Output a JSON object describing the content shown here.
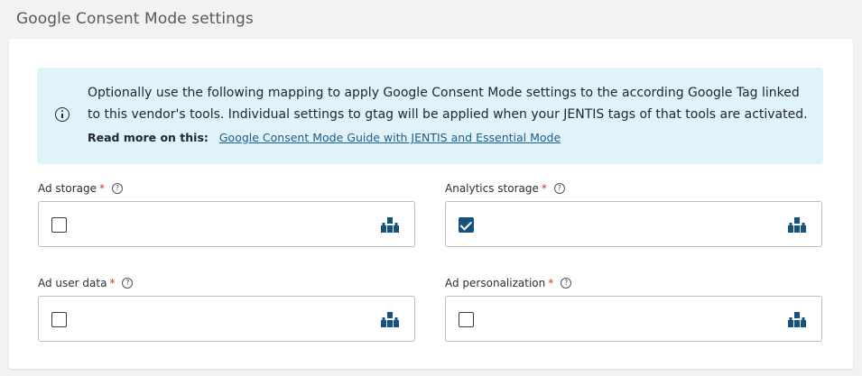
{
  "section": {
    "title": "Google Consent Mode settings"
  },
  "info": {
    "text": "Optionally use the following mapping to apply Google Consent Mode settings to the according Google Tag linked to this vendor's tools. Individual settings to gtag will be applied when your JENTIS tags of that tools are activated.",
    "read_more_label": "Read more on this:",
    "link_text": "Google Consent Mode Guide with JENTIS and Essential Mode"
  },
  "fields": [
    {
      "label": "Ad storage",
      "required_mark": "*",
      "help": "?",
      "checked": false,
      "icon": "building-blocks-icon"
    },
    {
      "label": "Analytics storage",
      "required_mark": "*",
      "help": "?",
      "checked": true,
      "icon": "building-blocks-icon"
    },
    {
      "label": "Ad user data",
      "required_mark": "*",
      "help": "?",
      "checked": false,
      "icon": "building-blocks-icon"
    },
    {
      "label": "Ad personalization",
      "required_mark": "*",
      "help": "?",
      "checked": false,
      "icon": "building-blocks-icon"
    }
  ],
  "colors": {
    "accent": "#16527e",
    "link": "#1a5e8c",
    "info_bg": "#e1f3fa",
    "required": "#d93025",
    "page_bg": "#f2f2f2"
  }
}
